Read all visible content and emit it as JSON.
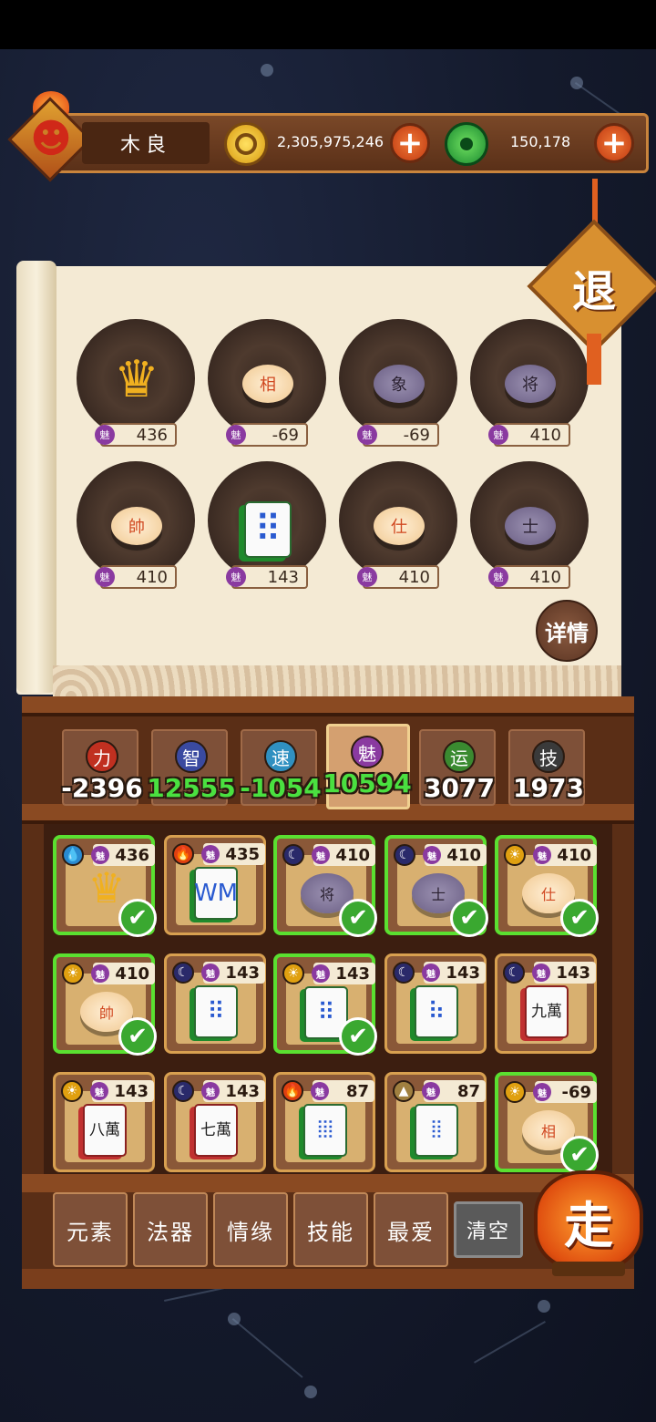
{
  "header": {
    "player_name": "木良",
    "gold": "2,305,975,246",
    "jade": "150,178",
    "plus_label": "+"
  },
  "scroll": {
    "exit_label": "退",
    "detail_label": "详情",
    "charm_badge": "魅",
    "slots": [
      {
        "kind": "crown-tile",
        "glyph": "♛",
        "charm": "436"
      },
      {
        "kind": "piece-cream",
        "glyph": "相",
        "charm": "-69"
      },
      {
        "kind": "piece-purple",
        "glyph": "象",
        "charm": "-69"
      },
      {
        "kind": "piece-purple",
        "glyph": "将",
        "charm": "410"
      },
      {
        "kind": "piece-cream",
        "glyph": "帥",
        "charm": "410"
      },
      {
        "kind": "tile",
        "glyph": "⠿",
        "charm": "143"
      },
      {
        "kind": "piece-cream",
        "glyph": "仕",
        "charm": "410"
      },
      {
        "kind": "piece-purple",
        "glyph": "士",
        "charm": "410"
      }
    ]
  },
  "stats": [
    {
      "label": "力",
      "value": "-2396",
      "icon_color": "#c03020",
      "value_color": "#ffffff",
      "active": false
    },
    {
      "label": "智",
      "value": "12555",
      "icon_color": "#3a4aa0",
      "value_color": "#4ae040",
      "active": false
    },
    {
      "label": "速",
      "value": "-1054",
      "icon_color": "#3090c0",
      "value_color": "#4ae040",
      "active": false
    },
    {
      "label": "魅",
      "value": "10594",
      "icon_color": "#8a3aa0",
      "value_color": "#4ae040",
      "active": true
    },
    {
      "label": "运",
      "value": "3077",
      "icon_color": "#3a8a30",
      "value_color": "#ffffff",
      "active": false
    },
    {
      "label": "技",
      "value": "1973",
      "icon_color": "#3a3a3a",
      "value_color": "#ffffff",
      "active": false
    }
  ],
  "cards": [
    {
      "element": "water-icon",
      "elem_glyph": "💧",
      "elem_color": "#2a8ad0",
      "charm": "436",
      "kind": "crown",
      "glyph": "♛",
      "selected": true
    },
    {
      "element": "fire-icon",
      "elem_glyph": "🔥",
      "elem_color": "#e04010",
      "charm": "435",
      "kind": "tile",
      "glyph": "WM",
      "selected": false
    },
    {
      "element": "moon-icon",
      "elem_glyph": "☾",
      "elem_color": "#2a2a6a",
      "charm": "410",
      "kind": "piece-purple",
      "glyph": "将",
      "selected": true
    },
    {
      "element": "moon-icon",
      "elem_glyph": "☾",
      "elem_color": "#2a2a6a",
      "charm": "410",
      "kind": "piece-purple",
      "glyph": "士",
      "selected": true
    },
    {
      "element": "sun-icon",
      "elem_glyph": "☀",
      "elem_color": "#e0a010",
      "charm": "410",
      "kind": "piece-cream",
      "glyph": "仕",
      "selected": true
    },
    {
      "element": "sun-icon",
      "elem_glyph": "☀",
      "elem_color": "#e0a010",
      "charm": "410",
      "kind": "piece-cream",
      "glyph": "帥",
      "selected": true
    },
    {
      "element": "moon-icon",
      "elem_glyph": "☾",
      "elem_color": "#2a2a6a",
      "charm": "143",
      "kind": "tile",
      "glyph": "⠿",
      "selected": false
    },
    {
      "element": "sun-icon",
      "elem_glyph": "☀",
      "elem_color": "#e0a010",
      "charm": "143",
      "kind": "tile",
      "glyph": "⠿",
      "selected": true
    },
    {
      "element": "moon-icon",
      "elem_glyph": "☾",
      "elem_color": "#2a2a6a",
      "charm": "143",
      "kind": "tile",
      "glyph": "⠷",
      "selected": false
    },
    {
      "element": "moon-icon",
      "elem_glyph": "☾",
      "elem_color": "#2a2a6a",
      "charm": "143",
      "kind": "tile-red",
      "glyph": "九萬",
      "selected": false
    },
    {
      "element": "sun-icon",
      "elem_glyph": "☀",
      "elem_color": "#e0a010",
      "charm": "143",
      "kind": "tile-red",
      "glyph": "八萬",
      "selected": false
    },
    {
      "element": "moon-icon",
      "elem_glyph": "☾",
      "elem_color": "#2a2a6a",
      "charm": "143",
      "kind": "tile-red",
      "glyph": "七萬",
      "selected": false
    },
    {
      "element": "fire-icon",
      "elem_glyph": "🔥",
      "elem_color": "#e04010",
      "charm": "87",
      "kind": "tile",
      "glyph": "⦙⦙⦙",
      "selected": false
    },
    {
      "element": "earth-icon",
      "elem_glyph": "▲",
      "elem_color": "#a08040",
      "charm": "87",
      "kind": "tile",
      "glyph": "⦙⦙",
      "selected": false
    },
    {
      "element": "sun-icon",
      "elem_glyph": "☀",
      "elem_color": "#e0a010",
      "charm": "-69",
      "kind": "piece-cream",
      "glyph": "相",
      "selected": true
    }
  ],
  "card_badge": "魅",
  "check_glyph": "✔",
  "categories": [
    "元素",
    "法器",
    "情缘",
    "技能",
    "最爱"
  ],
  "clear_label": "清空",
  "go_label": "走"
}
